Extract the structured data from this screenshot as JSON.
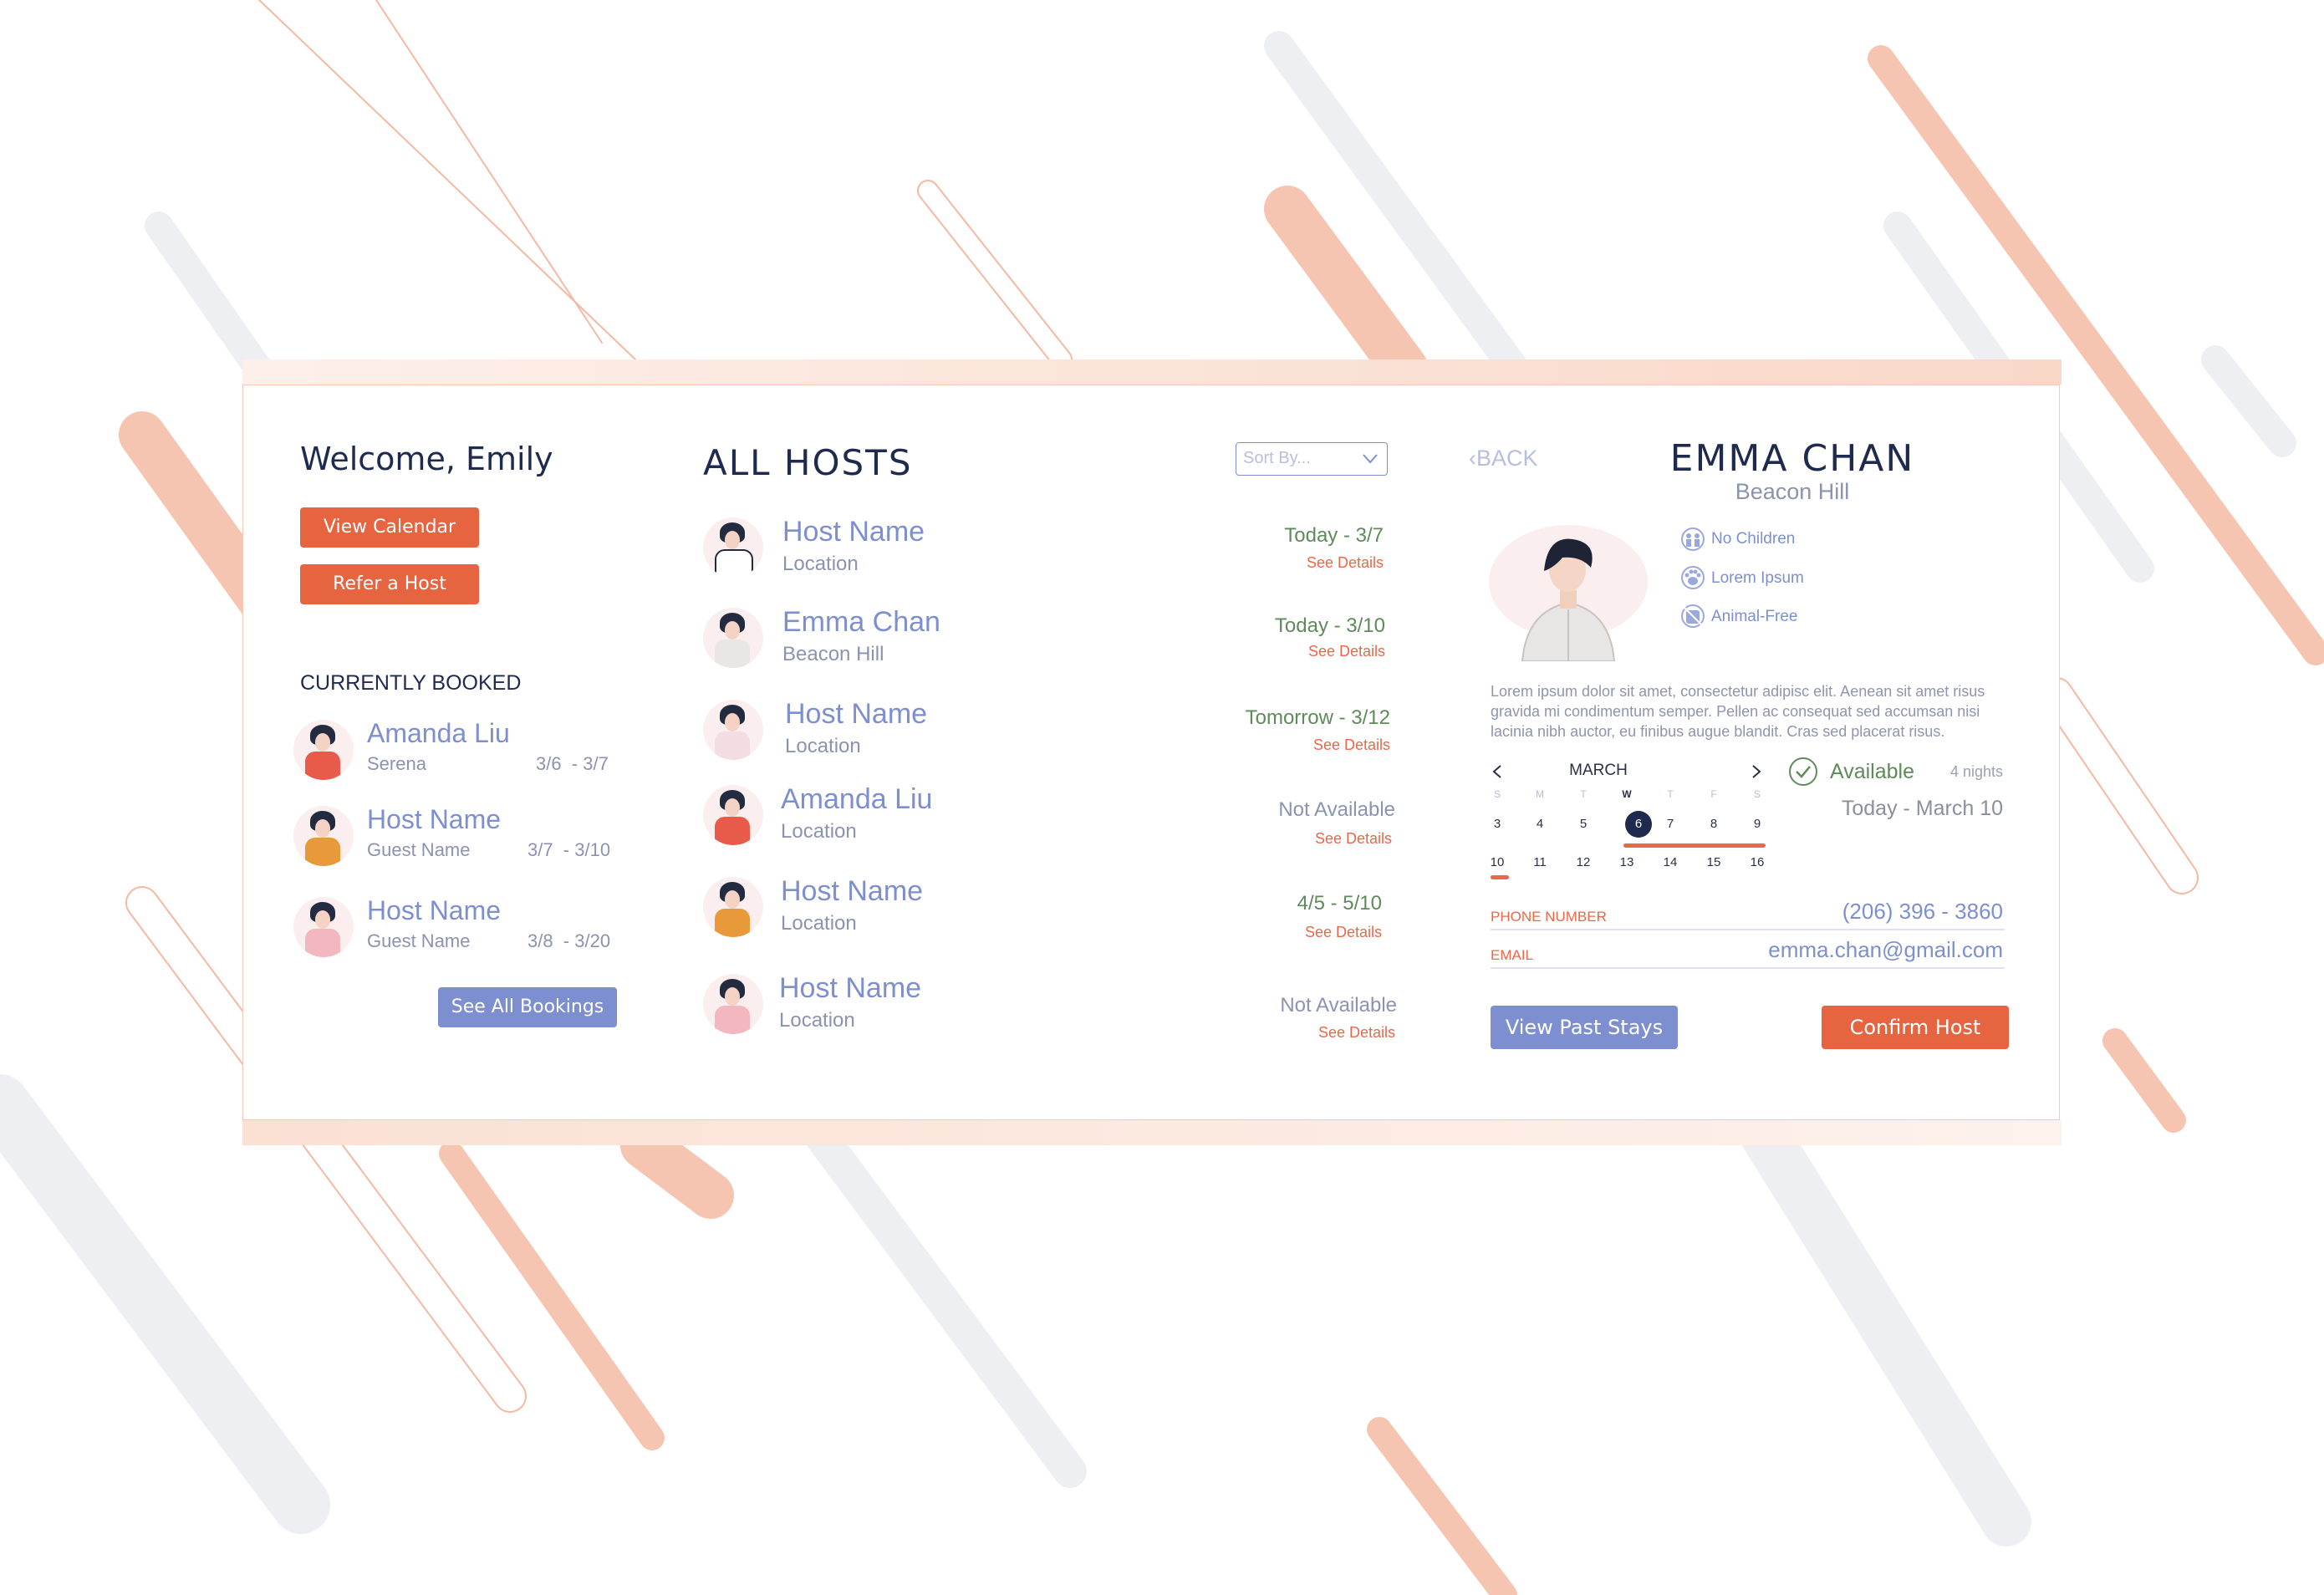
{
  "welcome": "Welcome, Emily",
  "sidebar": {
    "view_calendar": "View Calendar",
    "refer_host": "Refer a Host",
    "currently_booked_title": "CURRENTLY BOOKED",
    "bookings": [
      {
        "name": "Amanda Liu",
        "guest": "Serena",
        "dates": "3/6  - 3/7"
      },
      {
        "name": "Host Name",
        "guest": "Guest Name",
        "dates": "3/7  - 3/10"
      },
      {
        "name": "Host Name",
        "guest": "Guest Name",
        "dates": "3/8  - 3/20"
      }
    ],
    "see_all": "See All Bookings"
  },
  "hosts": {
    "title": "ALL HOSTS",
    "sort_placeholder": "Sort By...",
    "items": [
      {
        "name": "Host Name",
        "location": "Location",
        "availability": "Today - 3/7",
        "details": "See Details"
      },
      {
        "name": "Emma Chan",
        "location": "Beacon Hill",
        "availability": "Today - 3/10",
        "details": "See Details"
      },
      {
        "name": "Host Name",
        "location": "Location",
        "availability": "Tomorrow - 3/12",
        "details": "See Details"
      },
      {
        "name": "Amanda Liu",
        "location": "Location",
        "availability": "Not Available",
        "details": "See Details"
      },
      {
        "name": "Host Name",
        "location": "Location",
        "availability": "4/5 - 5/10",
        "details": "See Details"
      },
      {
        "name": "Host Name",
        "location": "Location",
        "availability": "Not Available",
        "details": "See Details"
      }
    ]
  },
  "detail": {
    "back": "BACK",
    "name": "EMMA CHAN",
    "location": "Beacon Hill",
    "tags": [
      {
        "label": "No Children",
        "icon": "no-children-icon"
      },
      {
        "label": "Lorem Ipsum",
        "icon": "paw-icon"
      },
      {
        "label": "Animal-Free",
        "icon": "no-animals-icon"
      }
    ],
    "bio": "Lorem ipsum dolor sit amet, consectetur adipisc elit. Aenean sit amet risus gravida mi condimentum semper. Pellen ac consequat sed accumsan nisi lacinia nibh auctor, eu finibus augue blandit. Cras sed placerat risus.",
    "calendar": {
      "month": "MARCH",
      "weekdays": [
        "S",
        "M",
        "T",
        "W",
        "T",
        "F",
        "S"
      ],
      "week1": [
        "3",
        "4",
        "5",
        "6",
        "7",
        "8",
        "9"
      ],
      "week2": [
        "10",
        "11",
        "12",
        "13",
        "14",
        "15",
        "16"
      ],
      "selected_day": "6"
    },
    "available": "Available",
    "nights": "4 nights",
    "range": "Today - March 10",
    "phone_label": "PHONE NUMBER",
    "phone": "(206) 396 - 3860",
    "email_label": "EMAIL",
    "email": "emma.chan@gmail.com",
    "view_past": "View Past Stays",
    "confirm": "Confirm Host"
  },
  "colors": {
    "coral": "#e6643f",
    "blue": "#7d8fd0",
    "navy": "#1f2a4f",
    "green": "#5f8a5a"
  }
}
